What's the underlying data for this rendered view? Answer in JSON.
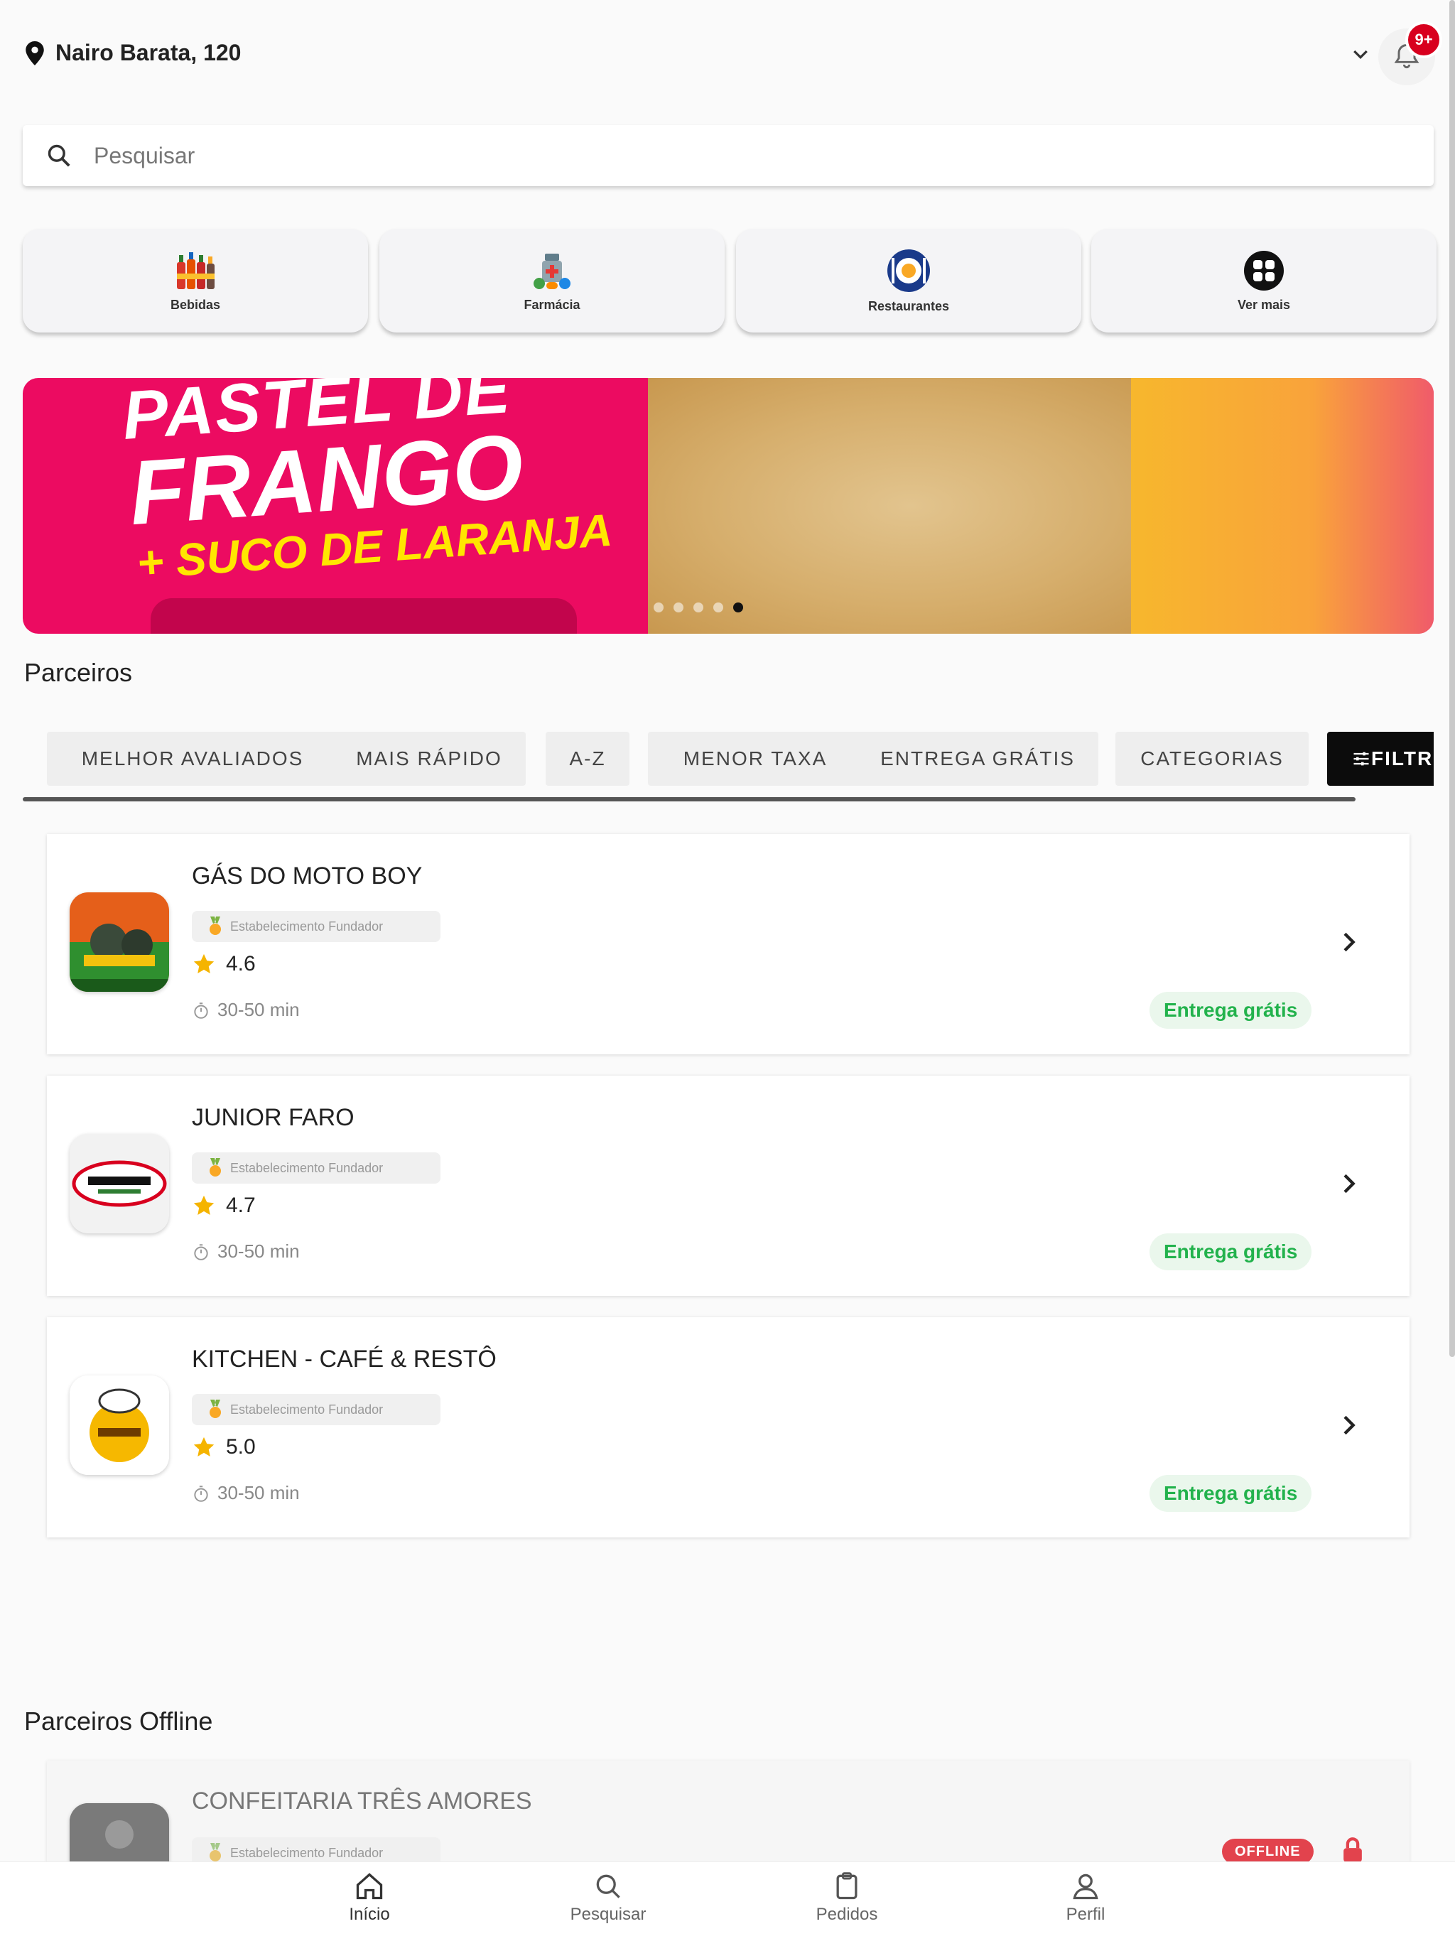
{
  "header": {
    "address": "Nairo Barata, 120",
    "notification_count": "9+"
  },
  "search": {
    "placeholder": "Pesquisar"
  },
  "categories": [
    {
      "label": "Bebidas",
      "icon": "bottles-icon"
    },
    {
      "label": "Farmácia",
      "icon": "pharmacy-icon"
    },
    {
      "label": "Restaurantes",
      "icon": "plate-icon"
    },
    {
      "label": "Ver mais",
      "icon": "grid-icon"
    }
  ],
  "banner": {
    "line1": "PASTEL DE",
    "line2": "FRANGO",
    "line3": "+ SUCO DE LARANJA",
    "slides": 5,
    "active_slide": 5
  },
  "partners": {
    "title": "Parceiros",
    "filters": [
      "MELHOR AVALIADOS",
      "MAIS RÁPIDO",
      "A-Z",
      "MENOR TAXA",
      "ENTREGA GRÁTIS",
      "CATEGORIAS",
      "FILTR"
    ],
    "items": [
      {
        "name": "GÁS DO MOTO BOY",
        "badge": "Estabelecimento Fundador",
        "rating": "4.6",
        "time": "30-50 min",
        "delivery": "Entrega grátis"
      },
      {
        "name": "JUNIOR FARO",
        "badge": "Estabelecimento Fundador",
        "rating": "4.7",
        "time": "30-50 min",
        "delivery": "Entrega grátis"
      },
      {
        "name": "KITCHEN - CAFÉ & RESTÔ",
        "badge": "Estabelecimento Fundador",
        "rating": "5.0",
        "time": "30-50 min",
        "delivery": "Entrega grátis"
      }
    ]
  },
  "offline": {
    "title": "Parceiros Offline",
    "items": [
      {
        "name": "CONFEITARIA TRÊS AMORES",
        "badge": "Estabelecimento Fundador",
        "status": "OFFLINE"
      }
    ]
  },
  "nav": [
    {
      "label": "Início",
      "icon": "home-icon"
    },
    {
      "label": "Pesquisar",
      "icon": "search-icon"
    },
    {
      "label": "Pedidos",
      "icon": "clipboard-icon"
    },
    {
      "label": "Perfil",
      "icon": "user-icon"
    }
  ],
  "colors": {
    "accent": "#ec0b61",
    "free_delivery": "#22b24c",
    "offline": "#e2434d",
    "badge_red": "#d8001e",
    "star": "#f5b400"
  }
}
